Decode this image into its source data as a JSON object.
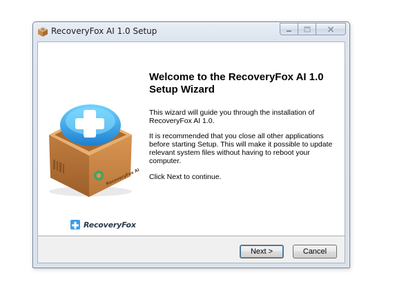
{
  "window": {
    "title": "RecoveryFox AI 1.0 Setup",
    "caption_buttons": [
      "minimize",
      "maximize",
      "close"
    ]
  },
  "wizard": {
    "heading": "Welcome to the RecoveryFox AI 1.0 Setup Wizard",
    "paragraphs": [
      "This wizard will guide you through the installation of RecoveryFox AI 1.0.",
      "It is recommended that you close all other applications before starting Setup. This will make it possible to update relevant system files without having to reboot your computer.",
      "Click Next to continue."
    ],
    "brand_name": "RecoveryFox",
    "box_label": "RecoveryFox AI"
  },
  "buttons": {
    "next_label": "Next >",
    "cancel_label": "Cancel"
  },
  "icons": {
    "app": "box-icon",
    "brand": "plus-logo-icon",
    "minimize": "minimize-icon",
    "maximize": "maximize-icon",
    "close": "close-icon"
  },
  "colors": {
    "accent": "#3a9ee6",
    "box_brown": "#c98a4a",
    "titlebar": "#dde5ef"
  }
}
